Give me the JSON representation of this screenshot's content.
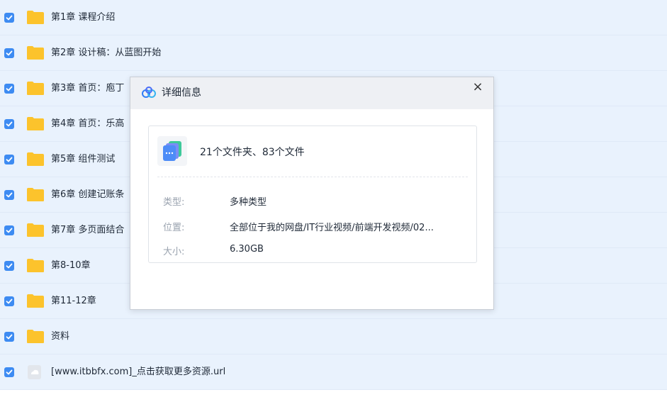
{
  "files": [
    {
      "name": "第1章 课程介绍",
      "type": "folder",
      "checked": true
    },
    {
      "name": "第2章 设计稿：从蓝图开始",
      "type": "folder",
      "checked": true
    },
    {
      "name": "第3章 首页：庖丁",
      "type": "folder",
      "checked": true
    },
    {
      "name": "第4章 首页：乐高",
      "type": "folder",
      "checked": true
    },
    {
      "name": "第5章 组件测试",
      "type": "folder",
      "checked": true
    },
    {
      "name": "第6章 创建记账条",
      "type": "folder",
      "checked": true
    },
    {
      "name": "第7章 多页面结合",
      "type": "folder",
      "checked": true
    },
    {
      "name": "第8-10章",
      "type": "folder",
      "checked": true
    },
    {
      "name": "第11-12章",
      "type": "folder",
      "checked": true
    },
    {
      "name": "资料",
      "type": "folder",
      "checked": true
    },
    {
      "name": "[www.itbbfx.com]_点击获取更多资源.url",
      "type": "url",
      "checked": true
    }
  ],
  "dialog": {
    "title": "详细信息",
    "close_label": "×",
    "summary": "21个文件夹、83个文件",
    "type_label": "类型:",
    "type_value": "多种类型",
    "location_label": "位置:",
    "location_value": "全部位于我的网盘/IT行业视频/前端开发视频/02...",
    "size_label": "大小:",
    "size_value": "6.30GB"
  },
  "colors": {
    "row_bg": "#e9f2fd",
    "checkbox": "#3d8bf2",
    "folder": "#fcc32c"
  }
}
